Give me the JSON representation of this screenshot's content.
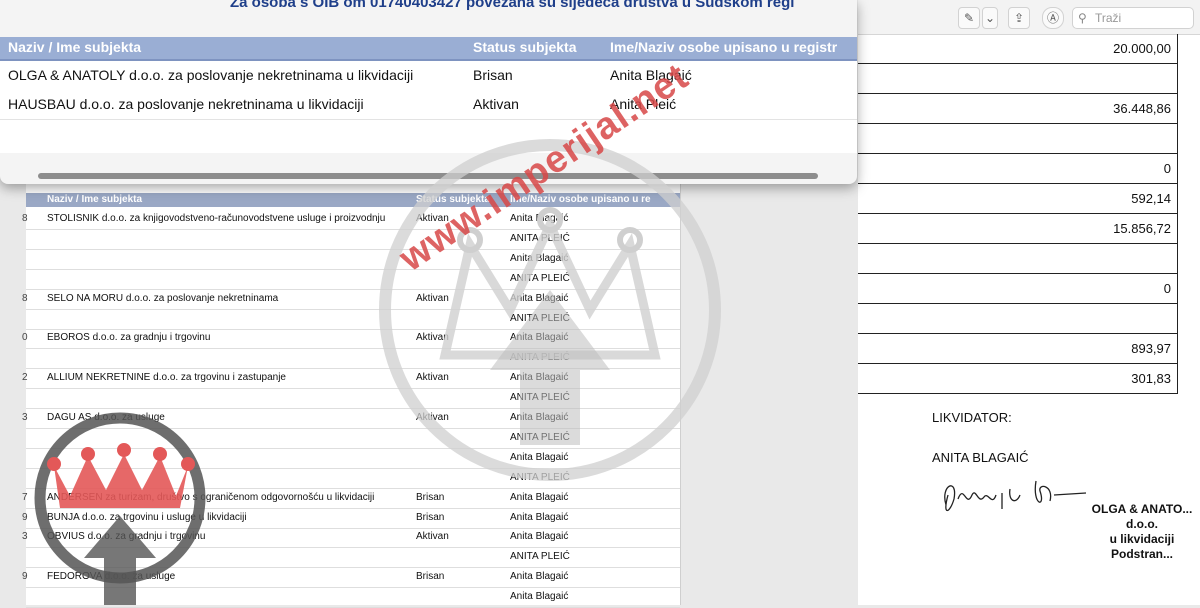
{
  "popup": {
    "title": "Za osoba s OIB om 01740403427 povezana su sljedeća društva u Sudskom regi",
    "columns": [
      "Naziv / Ime subjekta",
      "Status subjekta",
      "Ime/Naziv osobe upisano u registr"
    ],
    "rows": [
      {
        "name": "OLGA & ANATOLY d.o.o. za poslovanje nekretninama u likvidaciji",
        "status": "Brisan",
        "person": "Anita Blagaić"
      },
      {
        "name": "HAUSBAU d.o.o. za poslovanje nekretninama u likvidaciji",
        "status": "Aktivan",
        "person": "Anita Pleić"
      }
    ]
  },
  "toolbar": {
    "search_placeholder": "Traži",
    "icons": [
      "pen-icon",
      "chevron-down-icon",
      "share-icon",
      "markup-icon",
      "search-icon"
    ]
  },
  "amounts": [
    "20.000,00",
    "",
    "36.448,86",
    "",
    "0",
    "592,14",
    "15.856,72",
    "",
    "0",
    "",
    "893,97",
    "301,83"
  ],
  "signature": {
    "label": "LIKVIDATOR:",
    "name": "ANITA BLAGAIĆ",
    "stamp_lines": [
      "OLGA & ANATO...",
      "d.o.o.",
      "u likvidaciji",
      "Podstran..."
    ]
  },
  "left_table": {
    "columns": [
      "Naziv / Ime subjekta",
      "Status subjekta",
      "Ime/Naziv osobe upisano u re"
    ],
    "rows": [
      {
        "n": "8",
        "name": "STOLISNIK d.o.o. za knjigovodstveno-računovodstvene usluge i proizvodnju",
        "status": "Aktivan",
        "person": "Anita Blagaić"
      },
      {
        "n": "",
        "name": "",
        "status": "",
        "person": "ANITA PLEIĆ"
      },
      {
        "n": "",
        "name": "",
        "status": "",
        "person": "Anita Blagaić"
      },
      {
        "n": "",
        "name": "",
        "status": "",
        "person": "ANITA PLEIĆ"
      },
      {
        "n": "8",
        "name": "SELO NA MORU d.o.o. za poslovanje nekretninama",
        "status": "Aktivan",
        "person": "Anita Blagaić"
      },
      {
        "n": "",
        "name": "",
        "status": "",
        "person": "ANITA PLEIĆ"
      },
      {
        "n": "0",
        "name": "EBOROS d.o.o. za gradnju i trgovinu",
        "status": "Aktivan",
        "person": "Anita Blagaić"
      },
      {
        "n": "",
        "name": "",
        "status": "",
        "person": "ANITA PLEIĆ"
      },
      {
        "n": "2",
        "name": "ALLIUM NEKRETNINE d.o.o. za trgovinu i zastupanje",
        "status": "Aktivan",
        "person": "Anita Blagaić"
      },
      {
        "n": "",
        "name": "",
        "status": "",
        "person": "ANITA PLEIĆ"
      },
      {
        "n": "3",
        "name": "DAGU AS d.o.o. za usluge",
        "status": "Aktivan",
        "person": "Anita Blagaić"
      },
      {
        "n": "",
        "name": "",
        "status": "",
        "person": "ANITA PLEIĆ"
      },
      {
        "n": "",
        "name": "",
        "status": "",
        "person": "Anita Blagaić"
      },
      {
        "n": "",
        "name": "",
        "status": "",
        "person": "ANITA PLEIĆ"
      },
      {
        "n": "7",
        "name": "ANDERSEN za turizam, društvo s ograničenom odgovornošću u likvidaciji",
        "status": "Brisan",
        "person": "Anita Blagaić"
      },
      {
        "n": "9",
        "name": "BUNJA d.o.o. za trgovinu i usluge u likvidaciji",
        "status": "Brisan",
        "person": "Anita Blagaić"
      },
      {
        "n": "3",
        "name": "OBVIUS d.o.o. za gradnju i trgovinu",
        "status": "Aktivan",
        "person": "Anita Blagaić"
      },
      {
        "n": "",
        "name": "",
        "status": "",
        "person": "ANITA PLEIĆ"
      },
      {
        "n": "9",
        "name": "FEDOROVA d.o.o. za usluge",
        "status": "Brisan",
        "person": "Anita Blagaić"
      },
      {
        "n": "",
        "name": "",
        "status": "",
        "person": "Anita Blagaić"
      }
    ]
  },
  "watermark": {
    "text": "www.imperijal.net",
    "color": "#d84848"
  }
}
